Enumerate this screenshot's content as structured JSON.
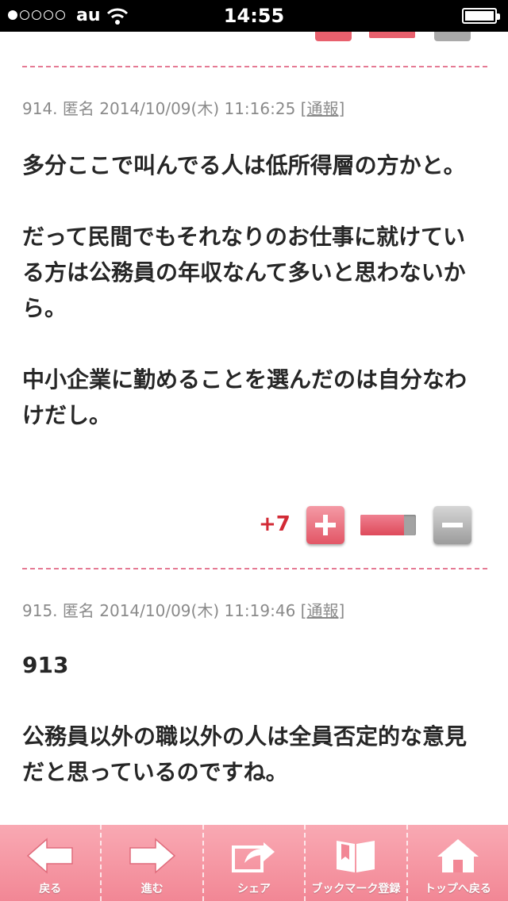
{
  "status_bar": {
    "carrier": "au",
    "time": "14:55",
    "signal_bars_filled": 1,
    "signal_bars_total": 5
  },
  "comments": [
    {
      "meta": "914. 匿名 2014/10/09(木) 11:16:25",
      "report_label": "[通報]",
      "paragraphs": [
        "多分ここで叫んでる人は低所得層の方かと。",
        "だって民間でもそれなりのお仕事に就けている方は公務員の年収なんて多いと思わないから。",
        "中小企業に勤めることを選んだのは自分なわけだし。"
      ],
      "vote": {
        "count": "+7",
        "plus_ratio": 0.78
      }
    },
    {
      "meta": "915. 匿名 2014/10/09(木) 11:19:46",
      "report_label": "[通報]",
      "paragraphs": [
        "913",
        "公務員以外の職以外の人は全員否定的な意見だと思っているのですね。"
      ]
    }
  ],
  "toolbar": {
    "back": "戻る",
    "forward": "進む",
    "share": "シェア",
    "bookmark": "ブックマーク登録",
    "top": "トップへ戻る"
  },
  "colors": {
    "accent_pink": "#f28795",
    "vote_red": "#d22a35",
    "divider": "#e57a94"
  }
}
